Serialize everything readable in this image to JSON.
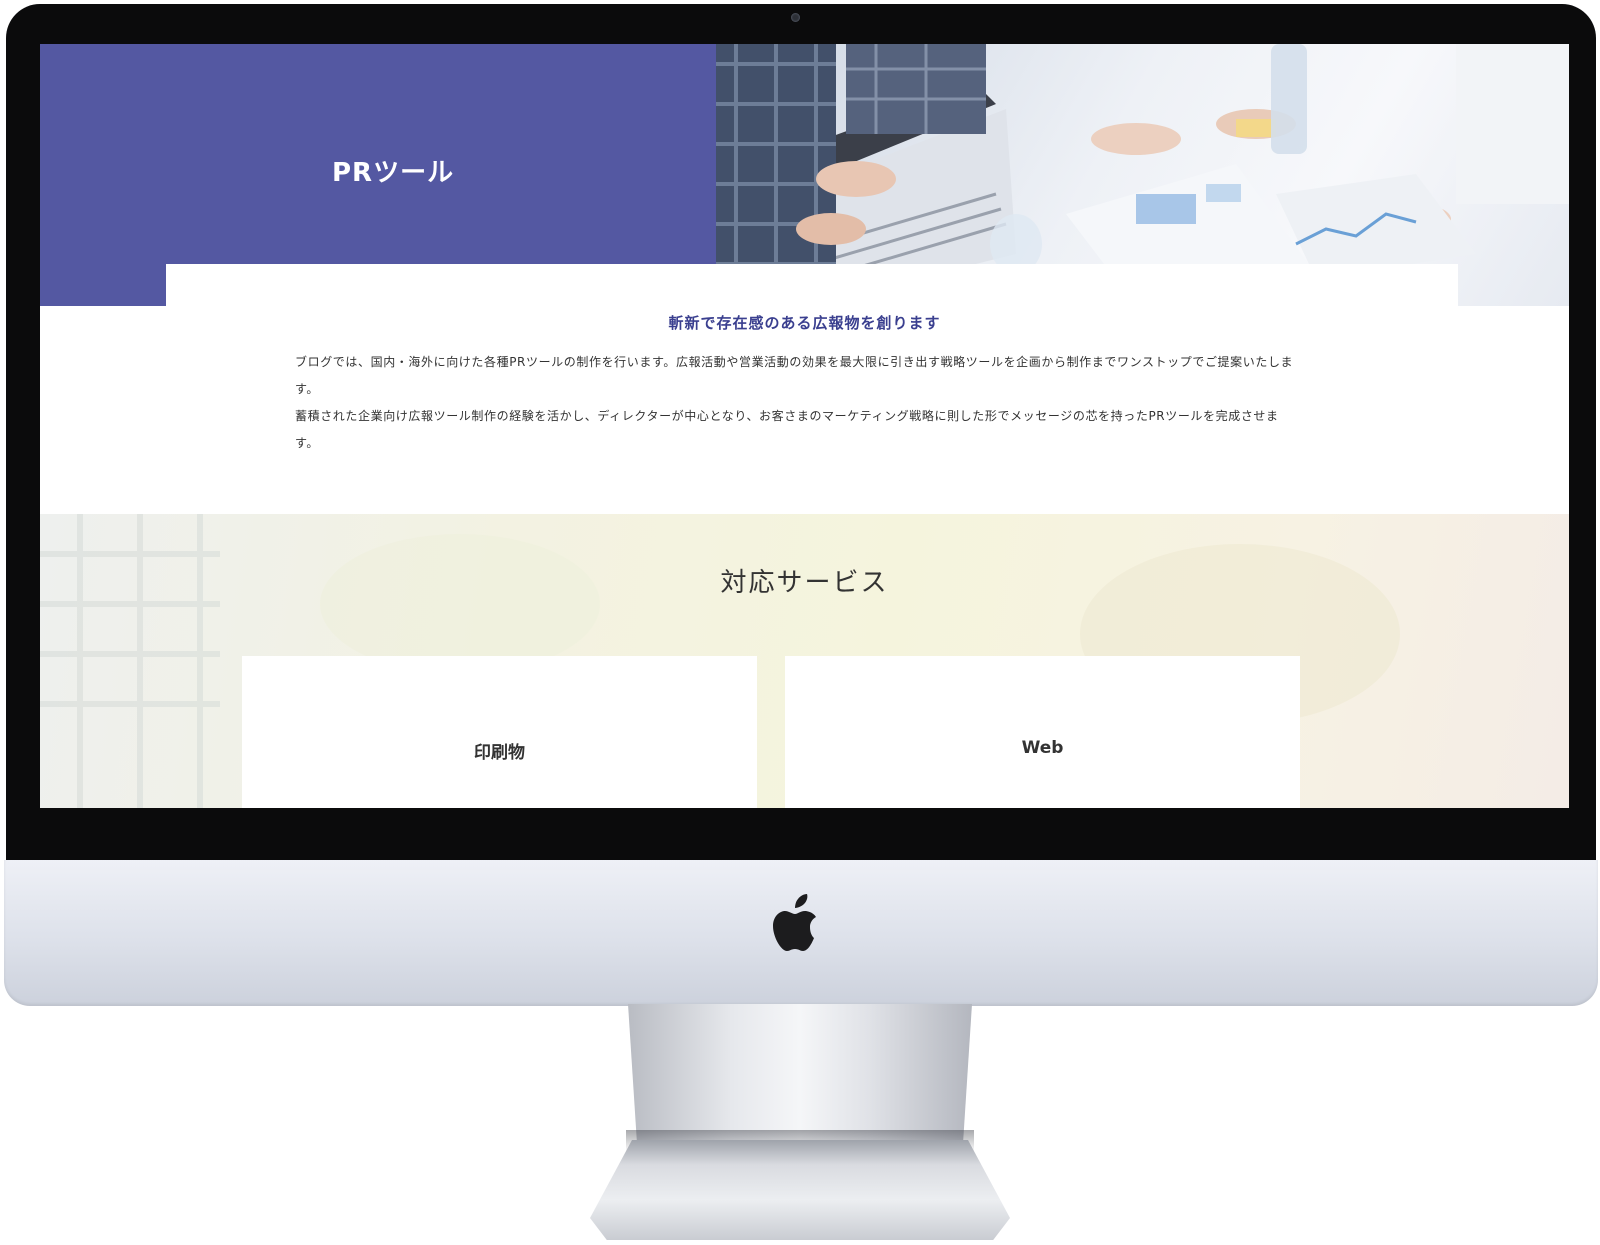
{
  "hero": {
    "title": "PRツール",
    "brand_color": "#5458a2"
  },
  "intro": {
    "heading": "斬新で存在感のある広報物を創ります",
    "paragraphs": [
      "ブログでは、国内・海外に向けた各種PRツールの制作を行います。広報活動や営業活動の効果を最大限に引き出す戦略ツールを企画から制作までワンストップでご提案いたします。",
      "蓄積された企業向け広報ツール制作の経験を活かし、ディレクターが中心となり、お客さまのマーケティング戦略に則した形でメッセージの芯を持ったPRツールを完成させます。"
    ]
  },
  "services": {
    "title": "対応サービス",
    "items": [
      {
        "label": "印刷物"
      },
      {
        "label": "Web"
      }
    ]
  },
  "device": {
    "logo_icon": "apple-logo-icon"
  }
}
